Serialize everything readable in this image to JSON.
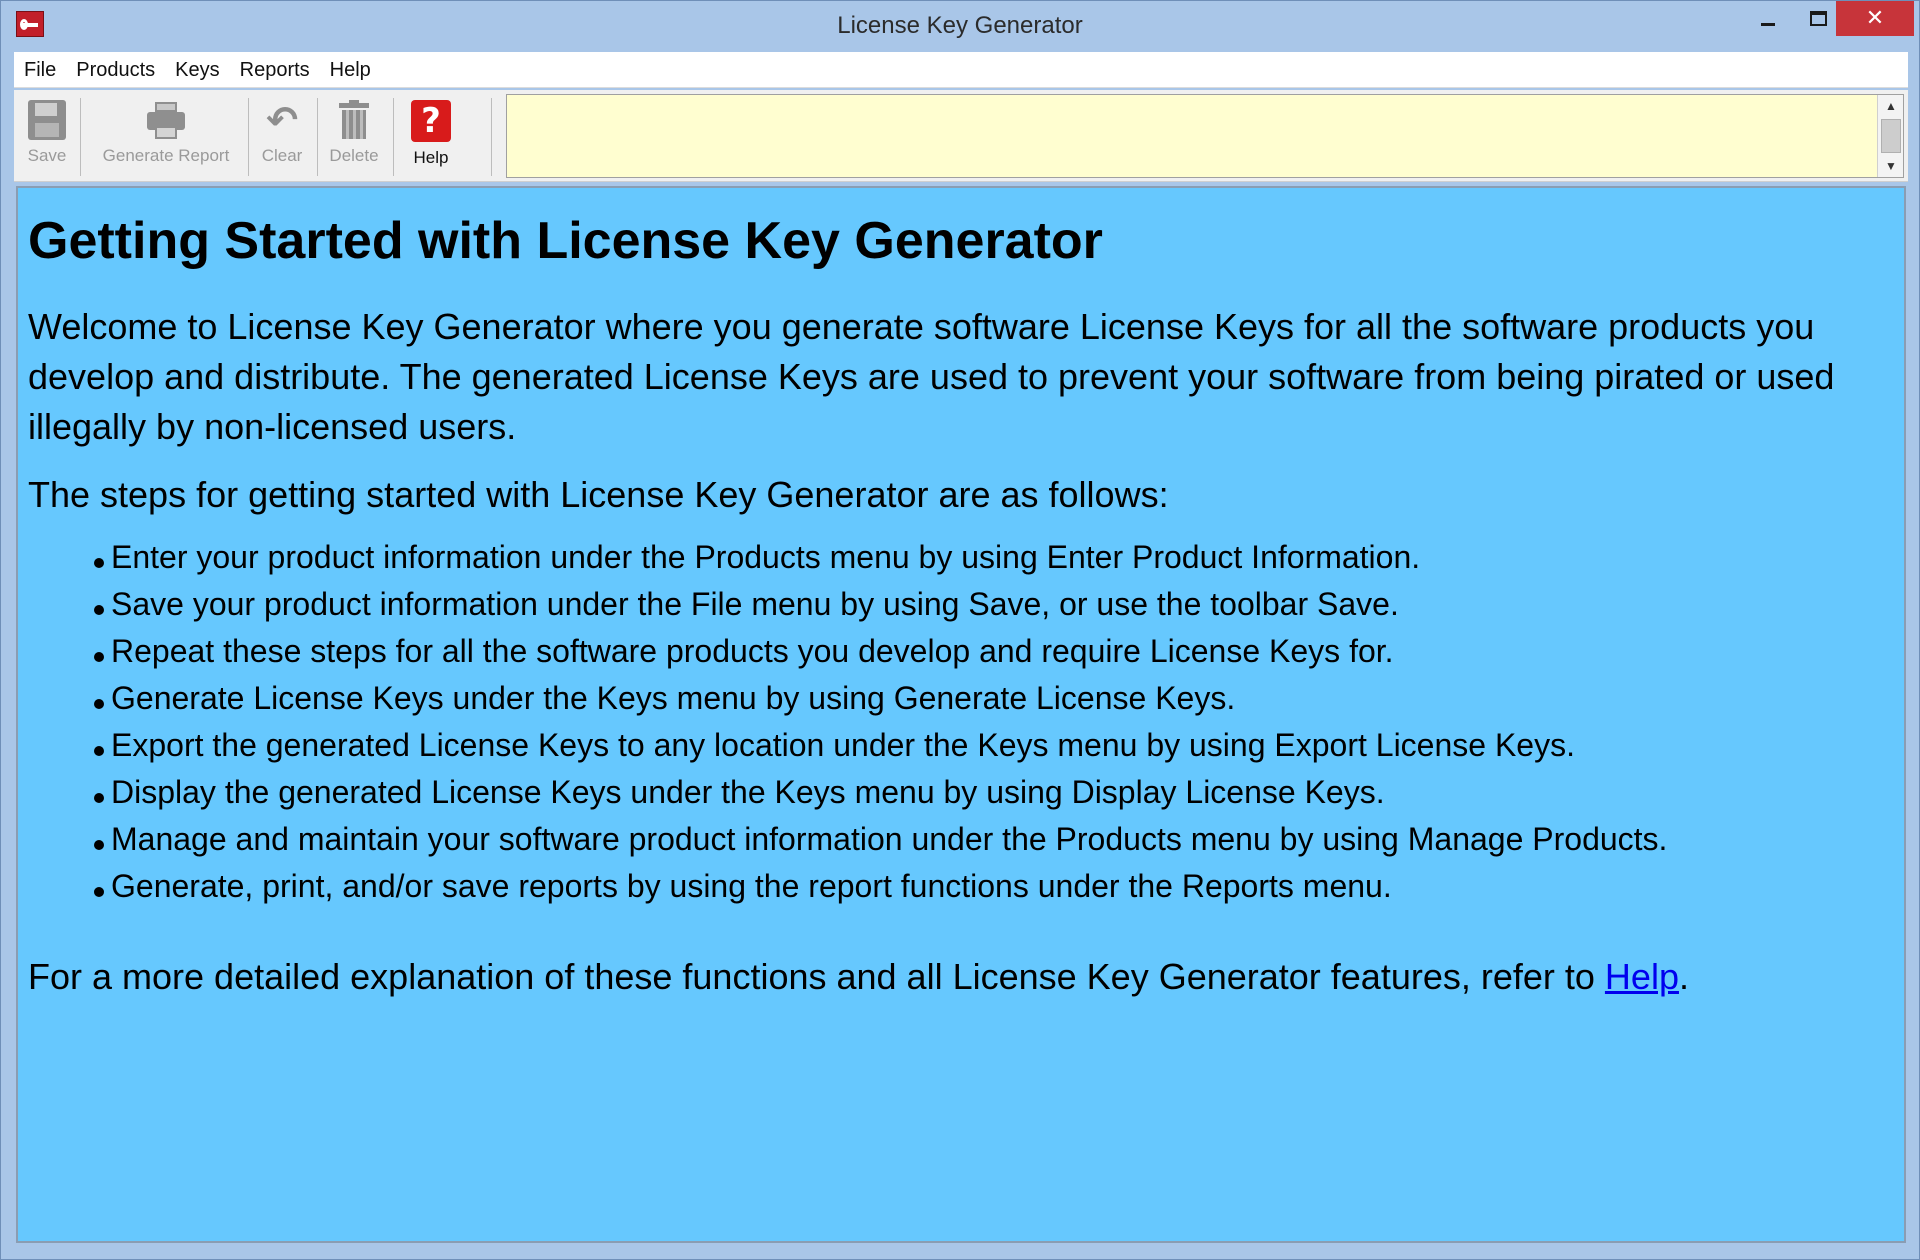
{
  "window": {
    "title": "License Key Generator"
  },
  "menu": {
    "items": [
      "File",
      "Products",
      "Keys",
      "Reports",
      "Help"
    ]
  },
  "toolbar": {
    "save_label": "Save",
    "report_label": "Generate Report",
    "clear_label": "Clear",
    "delete_label": "Delete",
    "help_label": "Help",
    "help_glyph": "?",
    "clear_glyph": "↶",
    "message_text": ""
  },
  "content": {
    "heading": "Getting Started with License Key Generator",
    "intro": "Welcome to License Key Generator where you generate software License Keys for all the software products you develop and distribute. The generated License Keys are used to prevent your software from being pirated or used illegally by non-licensed users.",
    "steps_intro": "The steps for getting started with License Key Generator are as follows:",
    "steps": [
      "Enter your product information under the Products menu by using Enter Product Information.",
      "Save your product information under the File menu by using Save, or use the toolbar Save.",
      "Repeat these steps for all the software products you develop and require License Keys for.",
      "Generate License Keys under the Keys menu by using Generate License Keys.",
      "Export the generated License Keys to any location under the Keys menu by using Export License Keys.",
      "Display the generated License Keys under the Keys menu by using Display License Keys.",
      "Manage and maintain your software product information under the Products menu by using Manage Products.",
      "Generate, print, and/or save reports by using the report functions under the Reports menu."
    ],
    "footer_prefix": "For a more detailed explanation of these functions and all License Key Generator features, refer to ",
    "footer_link": "Help",
    "footer_suffix": "."
  },
  "colors": {
    "content_background": "#66c8fe",
    "message_background": "#fffed0",
    "close_button": "#c7343a",
    "link": "#0000ee"
  },
  "icons": {
    "app": "license-key-icon",
    "save": "floppy-disk-icon",
    "report": "printer-icon",
    "clear": "undo-arrow-icon",
    "delete": "trash-can-icon",
    "help": "question-mark-icon"
  }
}
